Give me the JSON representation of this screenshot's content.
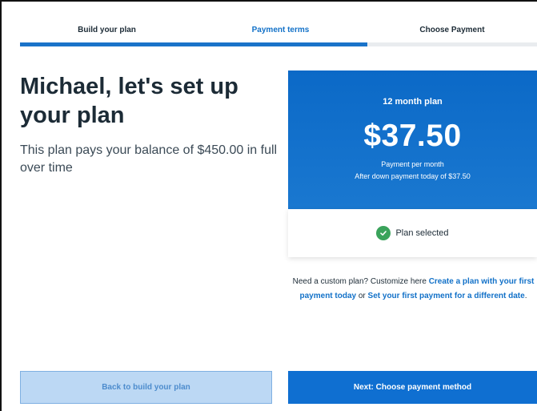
{
  "steps": [
    {
      "label": "Build your plan"
    },
    {
      "label": "Payment terms"
    },
    {
      "label": "Choose Payment"
    }
  ],
  "progress": {
    "completed_steps": 2,
    "total_steps": 3
  },
  "headline": "Michael, let's set up your plan",
  "subtext": "This plan pays your balance of $450.00 in full over time",
  "plan": {
    "name": "12 month plan",
    "price": "$37.50",
    "per": "Payment per month",
    "down_payment": "After down payment today of $37.50",
    "status": "Plan selected",
    "status_icon": "check-circle-icon"
  },
  "custom": {
    "prefix": "Need a custom plan? Customize here ",
    "link1": "Create a plan with your first payment today",
    "middle": " or ",
    "link2": "Set your first payment for a different date",
    "suffix": "."
  },
  "buttons": {
    "back": "Back to build your plan",
    "next": "Next: Choose payment method"
  },
  "colors": {
    "accent": "#1271c8",
    "card": "#0b69c7",
    "success": "#3aa35b"
  }
}
